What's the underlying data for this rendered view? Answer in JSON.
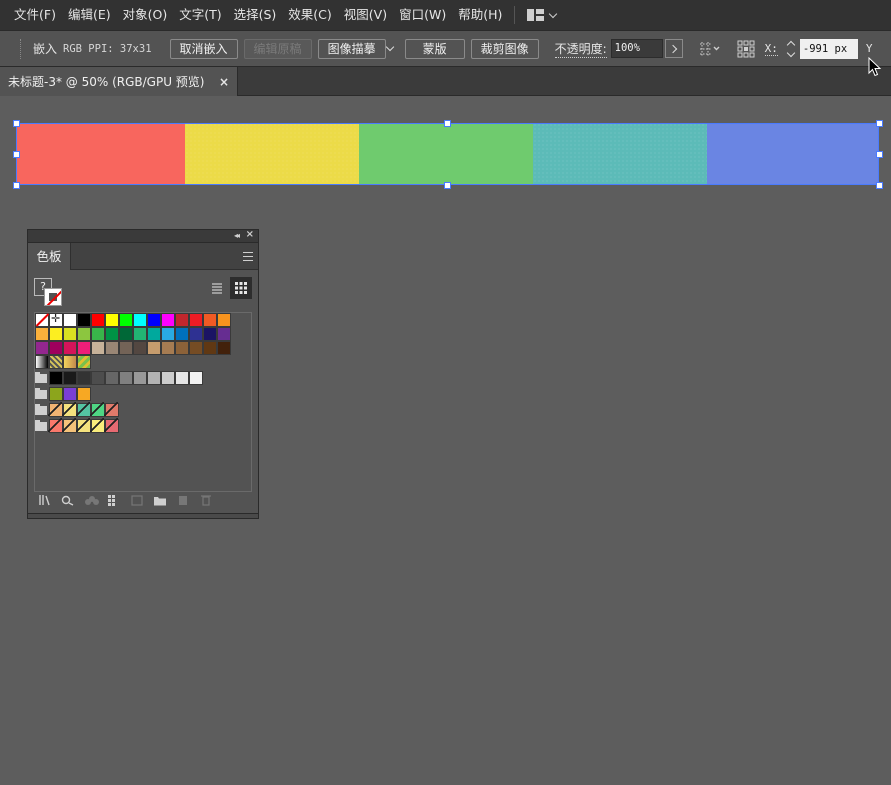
{
  "menu": {
    "items": [
      "文件(F)",
      "编辑(E)",
      "对象(O)",
      "文字(T)",
      "选择(S)",
      "效果(C)",
      "视图(V)",
      "窗口(W)",
      "帮助(H)"
    ],
    "workspace_icon": "workspace-layout-icon"
  },
  "control": {
    "embed_label": "嵌入",
    "image_info": "RGB  PPI: 37x31",
    "unembed_button": "取消嵌入",
    "edit_original_button": "编辑原稿",
    "image_trace_button": "图像描摹",
    "mask_button": "蒙版",
    "crop_button": "裁剪图像",
    "opacity_label": "不透明度:",
    "opacity_value": "100%",
    "x_label": "X:",
    "x_value": "-991 px",
    "y_label": "Y"
  },
  "tab": {
    "title": "未标题-3* @ 50% (RGB/GPU 预览)",
    "close": "×"
  },
  "artwork": {
    "stripes": [
      "#f8665e",
      "#ecdb48",
      "#6fcb6e",
      "#5cbbb8",
      "#6a85e3"
    ]
  },
  "panel": {
    "tab_label": "色板",
    "fill_label": "?",
    "rows": [
      [
        "none",
        "reg",
        "#ffffff",
        "#000000",
        "#ff0000",
        "#ffff00",
        "#00ff00",
        "#00ffff",
        "#0000ff",
        "#ff00ff",
        "#c1272d",
        "#ed1c24",
        "#f15a24",
        "#f7931e"
      ],
      [
        "#fbb03b",
        "#fcee21",
        "#d9e021",
        "#8cc63f",
        "#39b54a",
        "#009245",
        "#006837",
        "#22b573",
        "#00a99d",
        "#29abe2",
        "#0071bc",
        "#2e3192",
        "#1b1464",
        "#662d91"
      ],
      [
        "#93278f",
        "#9e005d",
        "#d4145a",
        "#ed1e79",
        "#c7b299",
        "#998675",
        "#736357",
        "#534741",
        "#c69c6d",
        "#a67c52",
        "#8c6239",
        "#754c24",
        "#603813",
        "#42210b"
      ]
    ],
    "gradient_row": [
      "#e6e6e6",
      "#d9c65a",
      "#c28a4c",
      "#79c24c"
    ],
    "gray_row": [
      "#000000",
      "#1a1a1a",
      "#333333",
      "#4d4d4d",
      "#666666",
      "#808080",
      "#999999",
      "#b3b3b3",
      "#cccccc",
      "#e6e6e6",
      "#f2f2f2"
    ],
    "group1": [
      "#8ca51c",
      "#7a3fd6",
      "#f7a823"
    ],
    "group2": [
      "#f2b472",
      "#f4e27e",
      "#54c3a2",
      "#4fd684",
      "#e07a6a"
    ],
    "group3": [
      "#f8786b",
      "#f4c27a",
      "#f4e27e",
      "#f9ec7c",
      "#e86a72"
    ]
  }
}
